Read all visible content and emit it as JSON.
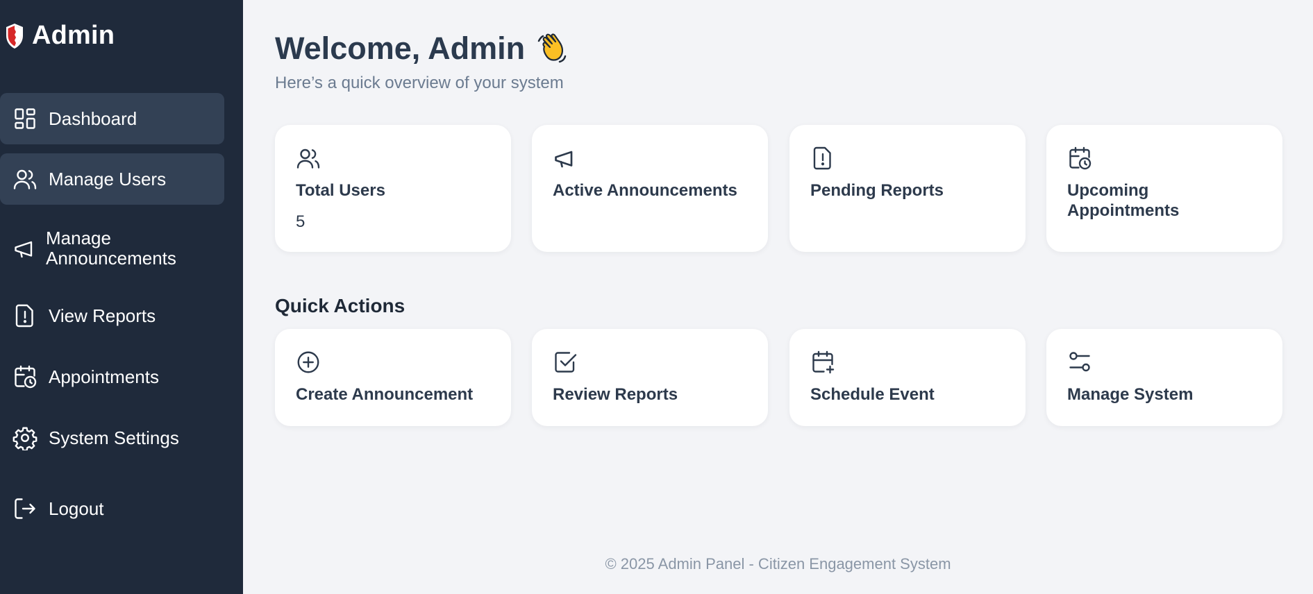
{
  "sidebar": {
    "brand": "Admin",
    "items": [
      {
        "label": "Dashboard",
        "icon": "dashboard-icon"
      },
      {
        "label": "Manage Users",
        "icon": "users-icon"
      },
      {
        "label": "Manage Announcements",
        "icon": "megaphone-icon"
      },
      {
        "label": "View Reports",
        "icon": "report-alert-icon"
      },
      {
        "label": "Appointments",
        "icon": "calendar-clock-icon"
      },
      {
        "label": "System Settings",
        "icon": "gear-icon"
      },
      {
        "label": "Logout",
        "icon": "logout-icon"
      }
    ]
  },
  "main": {
    "welcome": "Welcome, Admin",
    "welcome_icon": "waving-hand-icon",
    "subtitle": "Here’s a quick overview of your system",
    "stats": [
      {
        "title": "Total Users",
        "value": "5",
        "icon": "users-icon"
      },
      {
        "title": "Active Announcements",
        "value": "",
        "icon": "megaphone-icon"
      },
      {
        "title": "Pending Reports",
        "value": "",
        "icon": "report-alert-icon"
      },
      {
        "title": "Upcoming Appointments",
        "value": "",
        "icon": "calendar-clock-icon"
      }
    ],
    "quick_actions_title": "Quick Actions",
    "actions": [
      {
        "title": "Create Announcement",
        "icon": "plus-circle-icon"
      },
      {
        "title": "Review Reports",
        "icon": "checkbox-icon"
      },
      {
        "title": "Schedule Event",
        "icon": "calendar-plus-icon"
      },
      {
        "title": "Manage System",
        "icon": "sliders-icon"
      }
    ]
  },
  "footer": "© 2025 Admin Panel - Citizen Engagement System",
  "colors": {
    "sidebar_bg": "#1f2a3b",
    "active_item_bg": "#334155",
    "page_bg": "#f3f4f7",
    "card_bg": "#ffffff",
    "heading": "#2b3a4e",
    "muted": "#6b7b90",
    "logo_red": "#d62828"
  }
}
